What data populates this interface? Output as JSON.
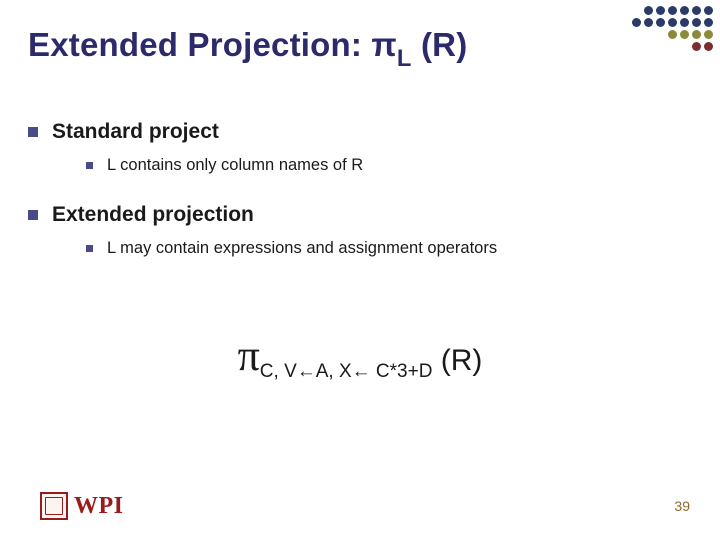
{
  "title_prefix": "Extended Projection: π",
  "title_sub": "L",
  "title_suffix": " (R)",
  "sections": [
    {
      "heading": "Standard project",
      "item": "L contains only column names of R"
    },
    {
      "heading": "Extended projection",
      "item": "L may contain expressions and assignment operators"
    }
  ],
  "formula": {
    "pi": "π",
    "sub1": "C,  V",
    "arrow1": "←",
    "sub2": "A,  X",
    "arrow2": "←",
    "sub3": " C*3+D",
    "tail": " (R)"
  },
  "logo_text": "WPI",
  "page_number": "39"
}
